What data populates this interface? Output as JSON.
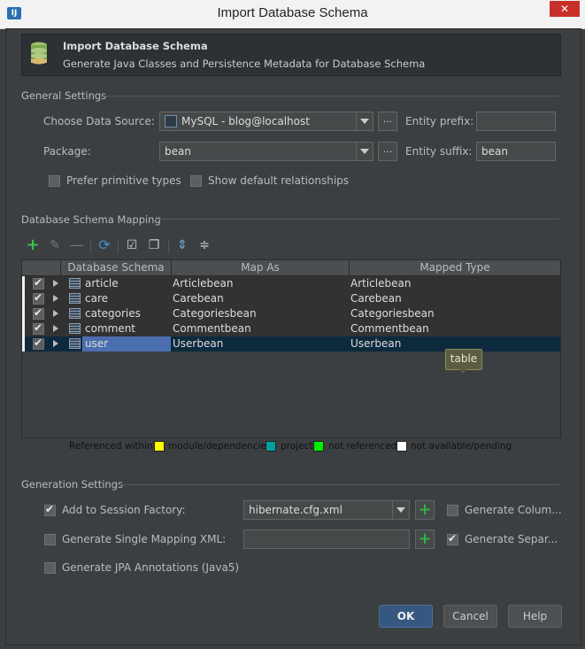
{
  "window": {
    "title": "Import Database Schema",
    "app_icon": "IJ",
    "close": "✕"
  },
  "header": {
    "title": "Import Database Schema",
    "subtitle": "Generate Java Classes and Persistence Metadata for Database Schema"
  },
  "general": {
    "section_title": "General Settings",
    "data_source_label": "Choose Data Source:",
    "data_source_value": "MySQL - blog@localhost",
    "entity_prefix_label": "Entity prefix:",
    "entity_prefix_value": "",
    "package_label": "Package:",
    "package_value": "bean",
    "entity_suffix_label": "Entity suffix:",
    "entity_suffix_value": "bean",
    "prefer_primitive_label": "Prefer primitive types",
    "show_default_rel_label": "Show default relationships",
    "browse": "..."
  },
  "mapping": {
    "section_title": "Database Schema Mapping",
    "columns": [
      "Database Schema",
      "Map As",
      "Mapped Type"
    ],
    "rows": [
      {
        "name": "article",
        "map_as": "Articlebean",
        "type": "Articlebean"
      },
      {
        "name": "care",
        "map_as": "Carebean",
        "type": "Carebean"
      },
      {
        "name": "categories",
        "map_as": "Categoriesbean",
        "type": "Categoriesbean"
      },
      {
        "name": "comment",
        "map_as": "Commentbean",
        "type": "Commentbean"
      },
      {
        "name": "user",
        "map_as": "Userbean",
        "type": "Userbean"
      }
    ],
    "tooltip": "table",
    "legend": {
      "prefix": "Referenced within:",
      "module": "module/dependencies",
      "project": "project",
      "not_referenced": "not referenced",
      "not_available": "not available/pending"
    },
    "colors": {
      "module": "#ffff00",
      "project": "#00a0a0",
      "not_referenced": "#00ee00",
      "not_available": "#ffffff"
    }
  },
  "generation": {
    "section_title": "Generation Settings",
    "add_session_label": "Add to Session Factory:",
    "session_value": "hibernate.cfg.xml",
    "single_mapping_label": "Generate Single Mapping XML:",
    "single_mapping_value": "",
    "jpa_label": "Generate JPA Annotations (Java5)",
    "gen_column_label": "Generate Colum...",
    "gen_separate_label": "Generate Separ..."
  },
  "buttons": {
    "ok": "OK",
    "cancel": "Cancel",
    "help": "Help"
  }
}
